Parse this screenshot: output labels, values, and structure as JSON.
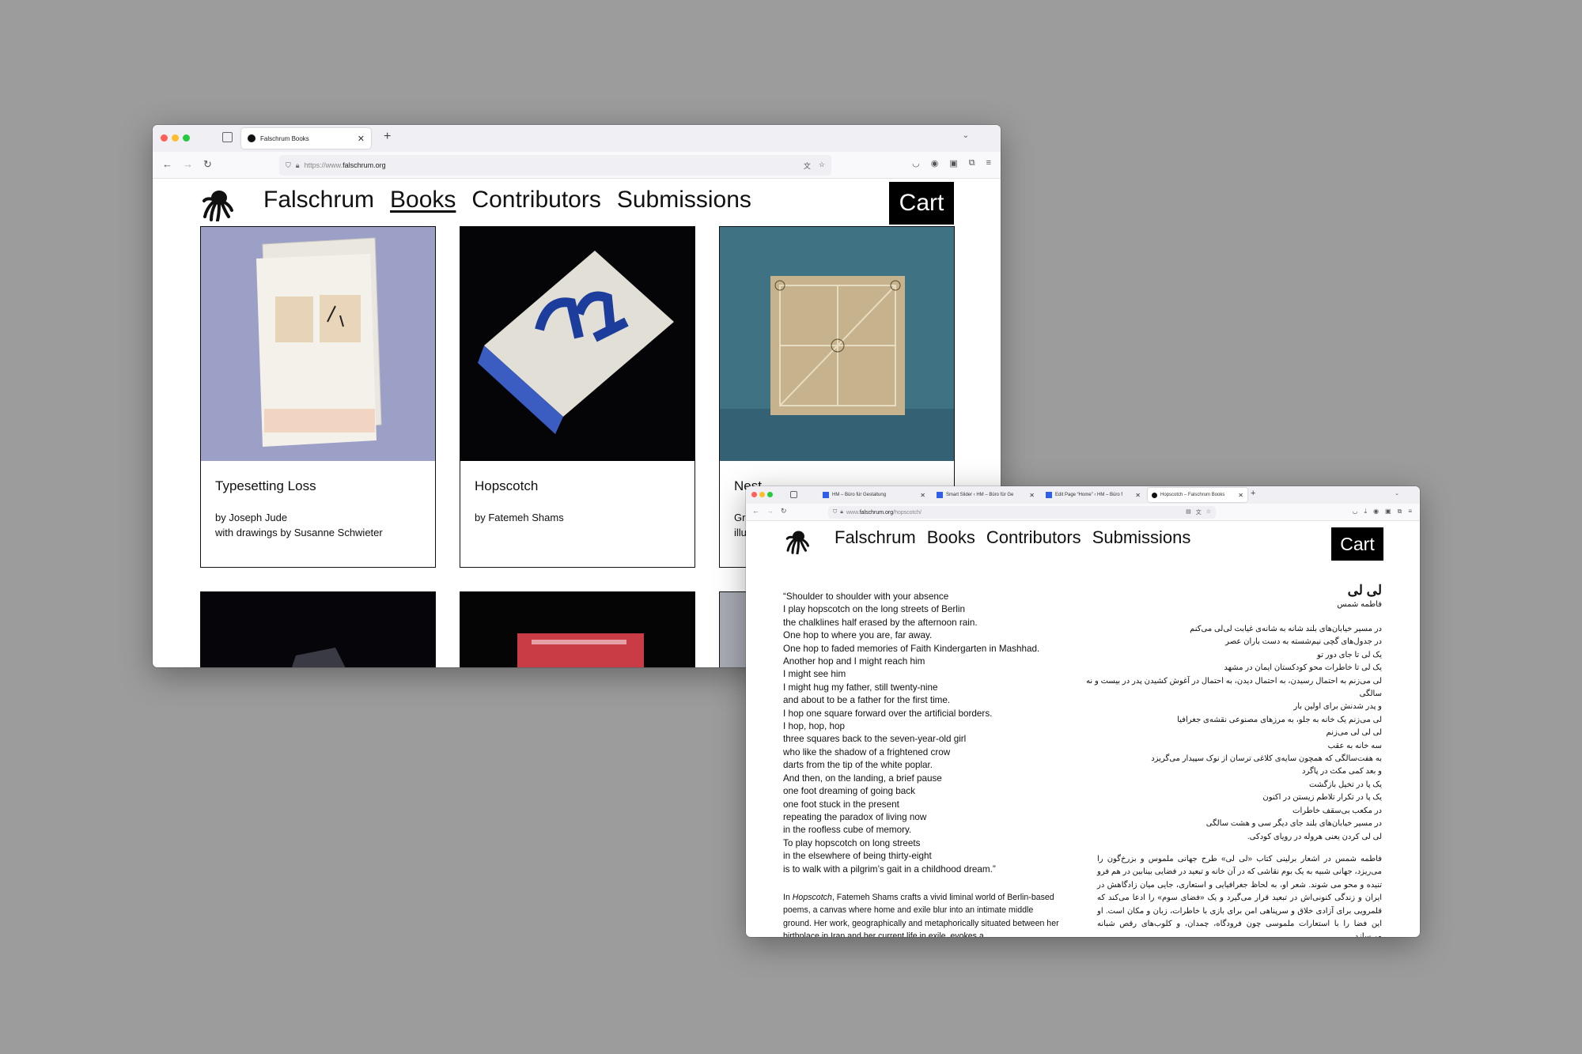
{
  "window1": {
    "tab_title": "Falschrum Books",
    "url_prefix": "https://www.",
    "url_host": "falschrum.org",
    "site": {
      "brand": "Falschrum",
      "nav": [
        "Books",
        "Contributors",
        "Submissions"
      ],
      "active_nav": "Books",
      "cart_label": "Cart"
    },
    "books": [
      {
        "title": "Typesetting Loss",
        "byline": "by Joseph Jude",
        "extra": "with drawings by Susanne Schwieter"
      },
      {
        "title": "Hopscotch",
        "byline": "by Fatemeh Shams",
        "extra": ""
      },
      {
        "title": "Nest",
        "byline": "Gr",
        "extra": "illu"
      }
    ]
  },
  "window2": {
    "tabs": [
      {
        "label": "HM – Büro für Gestaltung",
        "active": false
      },
      {
        "label": "Smart Slider ‹ HM – Büro für Ge",
        "active": false
      },
      {
        "label": "Edit Page “Home” ‹ HM – Büro f",
        "active": false
      },
      {
        "label": "Hopscotch – Falschrum Books",
        "active": true
      }
    ],
    "url_prefix": "www.",
    "url_host": "falschrum.org",
    "url_path": "/hopscotch/",
    "site": {
      "brand": "Falschrum",
      "nav": [
        "Books",
        "Contributors",
        "Submissions"
      ],
      "cart_label": "Cart"
    },
    "poem_lines": [
      "“Shoulder to shoulder with your absence",
      "I play hopscotch on the long streets of Berlin",
      "the chalklines half erased by the afternoon rain.",
      "One hop to where you are, far away.",
      "One hop to faded memories of Faith Kindergarten in Mashhad.",
      "Another hop and I might reach him",
      "I might see him",
      "I might hug my father, still twenty-nine",
      "and about to be a father for the first time.",
      "I hop one square forward over the artificial borders.",
      "I hop, hop, hop",
      "three squares back to the seven-year-old girl",
      "who like the shadow of a frightened crow",
      "darts from the tip of the white poplar.",
      "And then, on the landing, a brief pause",
      "one foot dreaming of going back",
      "one foot stuck in the present",
      "repeating the paradox of living now",
      "in the roofless cube of memory.",
      "To play hopscotch on long streets",
      "in the elsewhere of being thirty-eight",
      "is to walk with a pilgrim’s gait in a childhood dream.”"
    ],
    "blurb_prefix": "In ",
    "blurb_title": "Hopscotch",
    "blurb_rest": ", Fatemeh Shams crafts a vivid liminal world of Berlin-based poems, a canvas where home and exile blur into an intimate middle ground. Her work, geographically and metaphorically situated between her birthplace in Iran and her current life in exile, evokes a",
    "fa_title": "لی لی",
    "fa_author": "فاطمه شمس",
    "fa_poem_lines": [
      "در مسیر خیابان‌های بلند شانه به شانه‌ی غیابت لی‌لی می‌کنم",
      "در جدول‌های گچی نیم‌شسته به دست باران عصر",
      "یک لی تا جای دور تو",
      "یک لی تا خاطرات محو کودکستان ایمان در مشهد",
      "لی می‌زنم به احتمال رسیدن، به احتمال دیدن، به احتمال در آغوش کشیدن پدر در بیست و نه",
      "سالگی",
      "و پدر شدنش برای اولین بار",
      "لی می‌زنم یک خانه به جلو، به مرزهای مصنوعی نقشه‌ی جغرافیا",
      "لی لی لی می‌زنم",
      "سه خانه به عقب",
      "به هفت‌سالگی که همچون سایه‌ی کلاغی ترسان از نوک سپیدار می‌گریزد",
      "و بعد کمی مکث در پاگرد",
      "یک پا در تخیل بازگشت",
      "یک پا در تکرار تلاطم زیستن در اکنون",
      "در مکعب بی‌سقف خاطرات",
      "در مسیر خیابان‌های بلند جای دیگر سی و هشت سالگی",
      "لی لی کردن یعنی هروله در رویای کودکی."
    ],
    "fa_prose": "فاطمه شمس در اشعار برلینی کتاب «لی لی» طرح جهانی ملموس و بزرخ‌گون را می‌ریزد، جهانی شبیه به یک بوم نقاشی که در آن خانه و تبعید در فضایی بینابین در هم فرو تنیده و محو می شوند. شعر او، به لحاظ جغرافیایی و استعاری، جایی میان زادگاهش در ایران و زندگی کنونی‌اش در تبعید قرار می‌گیرد و یک «فضای سوم» را ادعا می‌کند که قلمرویی برای آزادی خلاق و سرپناهی امن برای بازی با خاطرات، زبان و مکان است. او این فضا را با استعارات ملموسی چون فرودگاه، چمدان، و کلوب‌های رقص شبانه می‌سازد"
  }
}
